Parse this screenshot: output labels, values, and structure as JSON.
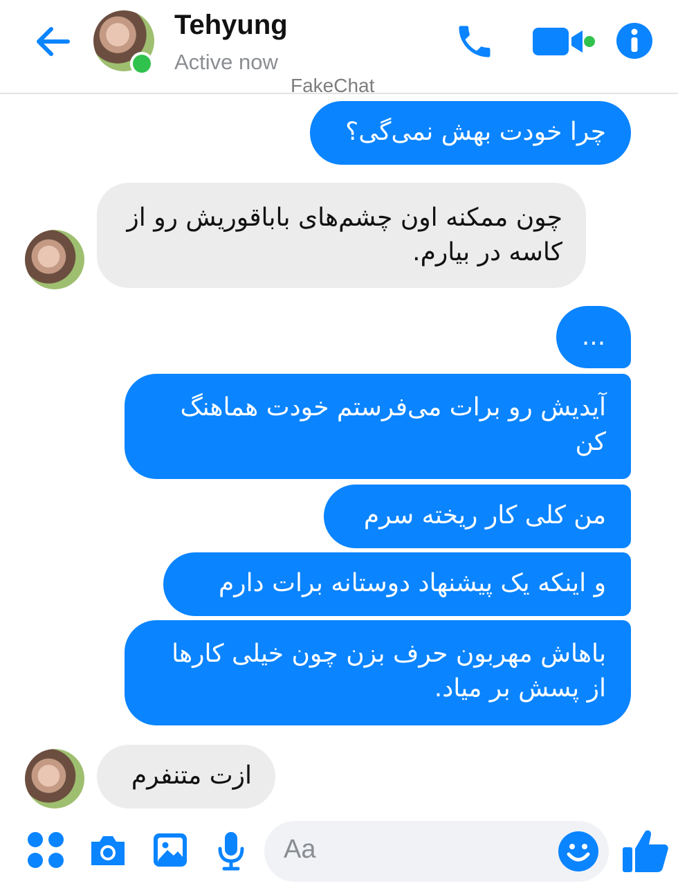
{
  "header": {
    "name": "Tehyung",
    "status": "Active now",
    "watermark": "FakeChat",
    "icons": [
      "back-arrow-icon",
      "phone-icon",
      "video-camera-icon",
      "info-icon"
    ]
  },
  "messages": [
    {
      "side": "out",
      "text": "چرا خودت بهش نمی‌گی؟"
    },
    {
      "side": "in",
      "text": "چون ممکنه اون چشم‌های باباقوریش رو از کاسه در بیارم."
    },
    {
      "side": "out",
      "text": "..."
    },
    {
      "side": "out",
      "text": "آیدیش رو برات می‌فرستم خودت هماهنگ کن"
    },
    {
      "side": "out",
      "text": "من کلی کار ریخته سرم"
    },
    {
      "side": "out",
      "text": "و اینکه یک پیشنهاد دوستانه برات دارم"
    },
    {
      "side": "out",
      "text": "باهاش مهربون حرف بزن چون خیلی کارها از پسش بر میاد."
    },
    {
      "side": "in",
      "text": "ازت متنفرم"
    }
  ],
  "composer": {
    "placeholder": "Aa",
    "icons": [
      "apps-icon",
      "camera-icon",
      "gallery-icon",
      "microphone-icon",
      "emoji-icon",
      "thumbs-up-icon"
    ]
  },
  "colors": {
    "accent": "#0a84ff",
    "incoming_bubble": "#ececec",
    "online": "#31c24d"
  }
}
